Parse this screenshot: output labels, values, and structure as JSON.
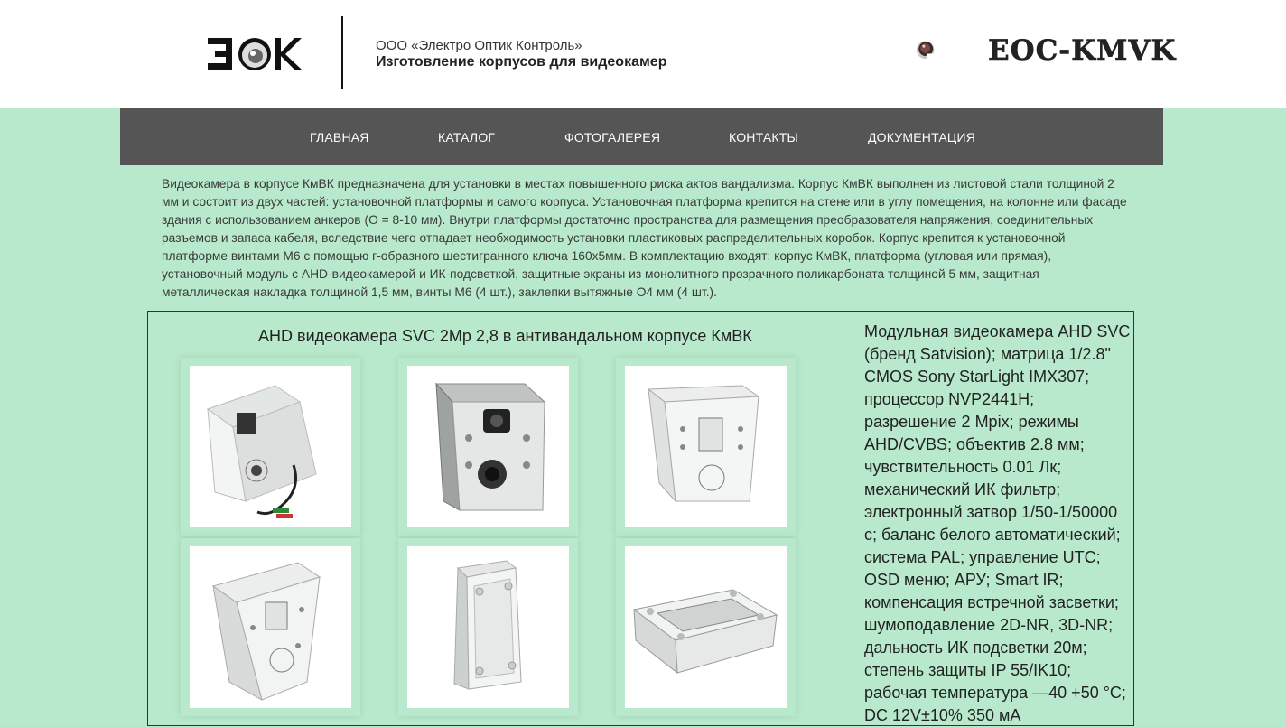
{
  "header": {
    "company_name": "ООО «Электро Оптик Контроль»",
    "tagline": "Изготовление корпусов для видеокамер",
    "brand_right": "EOC-KMVK",
    "logo_left_icon": "eok-logo-icon",
    "logo_right_icon": "eoc-kmvk-logo-icon"
  },
  "nav": {
    "items": [
      {
        "label": "ГЛАВНАЯ"
      },
      {
        "label": "КАТАЛОГ"
      },
      {
        "label": "ФОТОГАЛЕРЕЯ"
      },
      {
        "label": "КОНТАКТЫ"
      },
      {
        "label": "ДОКУМЕНТАЦИЯ"
      }
    ]
  },
  "intro": "Видеокамера в корпусе КмВК предназначена для установки в местах повышенного риска актов вандализма. Корпус КмВК выполнен из листовой стали толщиной 2 мм и состоит из двух частей: установочной платформы и самого корпуса. Установочная платформа крепится на стене или в углу помещения, на колонне или фасаде здания с использованием анкеров (O = 8-10 мм). Внутри платформы достаточно пространства для размещения преобразователя напряжения, соединительных разъемов и запаса кабеля, вследствие чего отпадает необходимость установки пластиковых распределительных коробок. Корпус крепится к установочной платформе винтами М6 с помощью г-образного шестигранного ключа 160x5мм. В комплектацию входят: корпус КмВК, платформа (угловая или прямая), установочный модуль с AHD-видеокамерой и ИК-подсветкой, защитные экраны из монолитного прозрачного поликарбоната толщиной 5 мм, защитная металлическая накладка толщиной 1,5 мм, винты М6 (4 шт.), заклепки вытяжные O4 мм (4 шт.).",
  "product": {
    "title": "AHD видеокамера SVC 2Mp 2,8 в антивандальном корпусе КмВК",
    "specs": "Модульная видеокамера AHD SVC (бренд Satvision); матрица 1/2.8\" CMOS Sony StarLight IMX307; процессор NVP2441H; разрешение 2 Mpix; режимы AHD/CVBS; объектив 2.8 мм; чувствительность 0.01 Лк; механический ИК фильтр; электронный затвор 1/50-1/50000 с; баланс белого автоматический; система PAL; управление UTC; OSD меню; АРУ; Smart IR; компенсация встречной засветки; шумоподавление 2D-NR, 3D-NR; дальность ИК подсветки 20м; степень защиты IP 55/IK10; рабочая температура —40 +50 °С; DC 12V±10% 350 мА",
    "photos": [
      {
        "icon": "camera-housing-front-icon"
      },
      {
        "icon": "camera-housing-open-icon"
      },
      {
        "icon": "housing-empty-angled-icon"
      },
      {
        "icon": "housing-side-view-icon"
      },
      {
        "icon": "corner-platform-icon"
      },
      {
        "icon": "flat-platform-icon"
      }
    ]
  }
}
